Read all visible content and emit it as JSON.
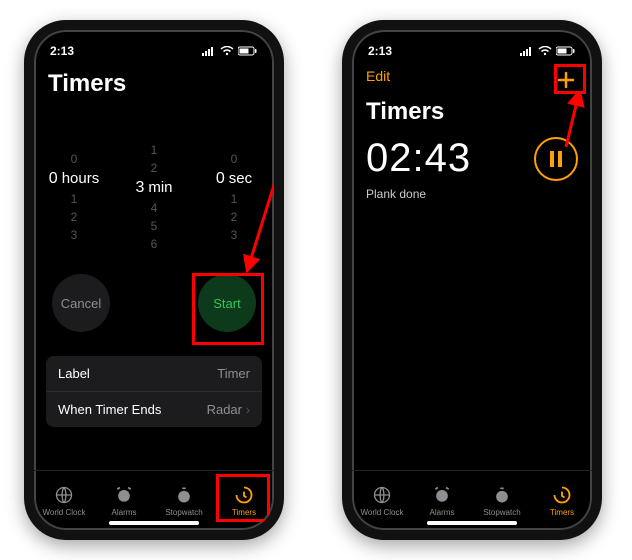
{
  "status": {
    "time": "2:13"
  },
  "phone1": {
    "title": "Timers",
    "picker": {
      "hours_above": [
        "0"
      ],
      "hours_val": "0",
      "hours_unit": "hours",
      "hours_below": [
        "1",
        "2",
        "3"
      ],
      "min_above": [
        "1",
        "2"
      ],
      "min_val": "3",
      "min_unit": "min",
      "min_below": [
        "4",
        "5",
        "6"
      ],
      "sec_above": [
        "0"
      ],
      "sec_val": "0",
      "sec_unit": "sec",
      "sec_below": [
        "1",
        "2",
        "3"
      ]
    },
    "cancel": "Cancel",
    "start": "Start",
    "label_key": "Label",
    "label_val": "Timer",
    "ends_key": "When Timer Ends",
    "ends_val": "Radar"
  },
  "phone2": {
    "edit": "Edit",
    "title": "Timers",
    "time": "02:43",
    "label": "Plank done"
  },
  "tabs": {
    "world": "World Clock",
    "alarms": "Alarms",
    "stopwatch": "Stopwatch",
    "timers": "Timers"
  }
}
